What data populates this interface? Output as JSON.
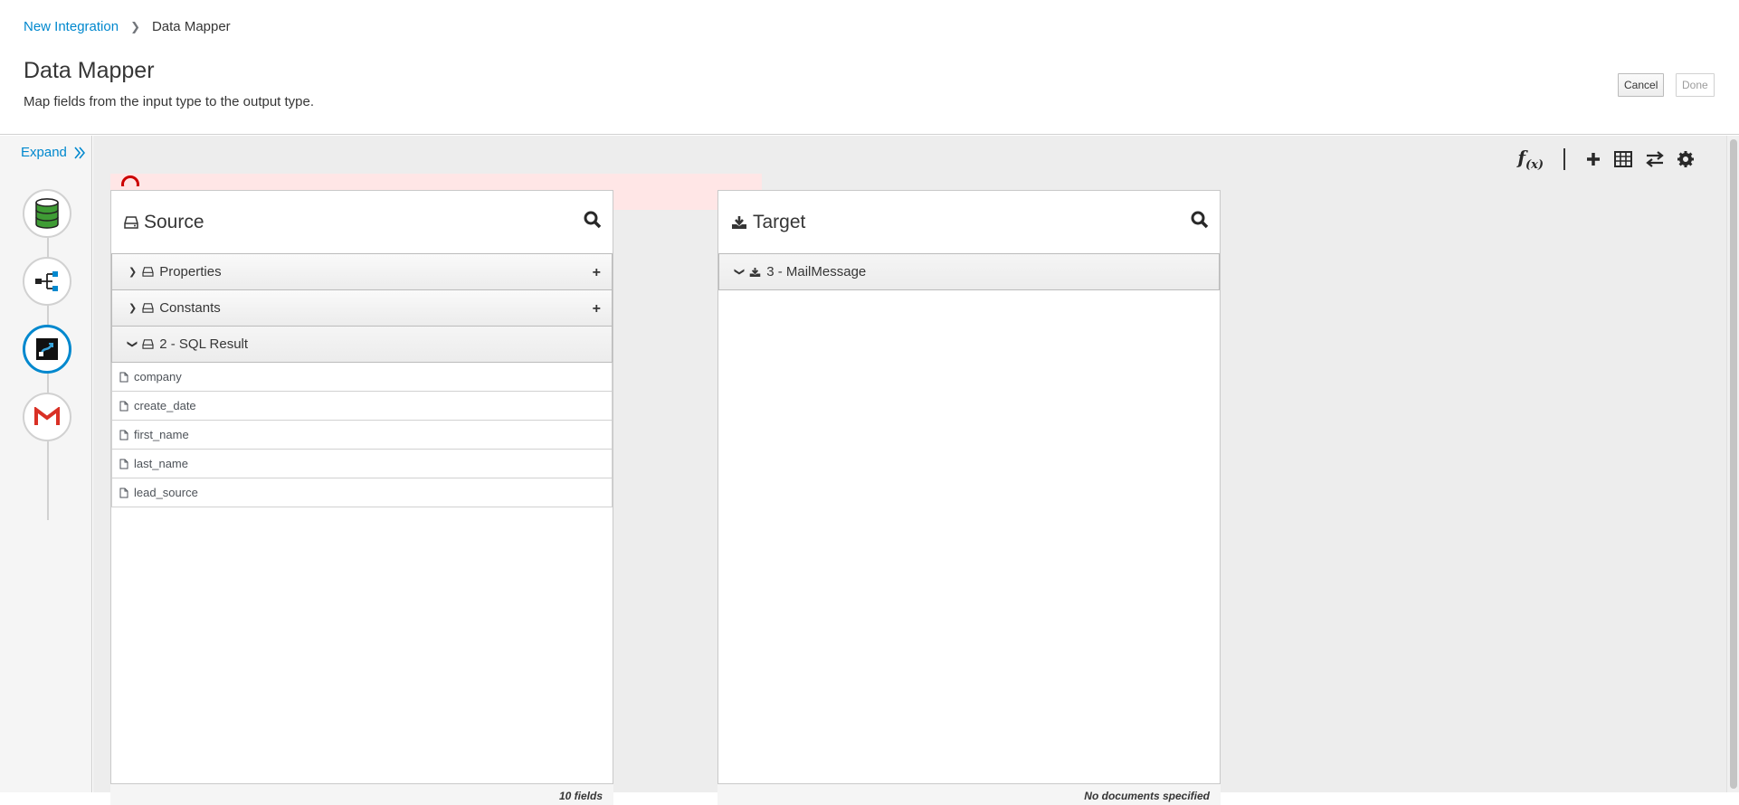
{
  "breadcrumb": {
    "parent": "New Integration",
    "current": "Data Mapper"
  },
  "page": {
    "title": "Data Mapper",
    "subtitle": "Map fields from the input type to the output type."
  },
  "actions": {
    "cancel": "Cancel",
    "done": "Done"
  },
  "rail": {
    "expand_label": "Expand",
    "steps": [
      {
        "icon": "database-icon",
        "active": false
      },
      {
        "icon": "split-icon",
        "active": false
      },
      {
        "icon": "data-mapper-icon",
        "active": true
      },
      {
        "icon": "gmail-icon",
        "active": false
      }
    ]
  },
  "toolbar": {
    "fx_label": "f",
    "fx_sub": "(x)",
    "icons": [
      "plus-icon",
      "table-icon",
      "exchange-icon",
      "gear-icon"
    ]
  },
  "source": {
    "title": "Source",
    "docs": [
      {
        "label": "Properties",
        "expanded": false
      },
      {
        "label": "Constants",
        "expanded": false
      },
      {
        "label": "2 - SQL Result",
        "expanded": true
      }
    ],
    "fields": [
      "company",
      "create_date",
      "first_name",
      "last_name",
      "lead_source"
    ],
    "footer": "10 fields"
  },
  "target": {
    "title": "Target",
    "docs": [
      {
        "label": "3 - MailMessage",
        "expanded": true
      }
    ],
    "footer": "No documents specified"
  },
  "colors": {
    "accent": "#0088ce",
    "error_bg": "#ffe6e6",
    "error": "#cc0000",
    "gmail_red": "#d93025",
    "db_green": "#3f9c35"
  }
}
